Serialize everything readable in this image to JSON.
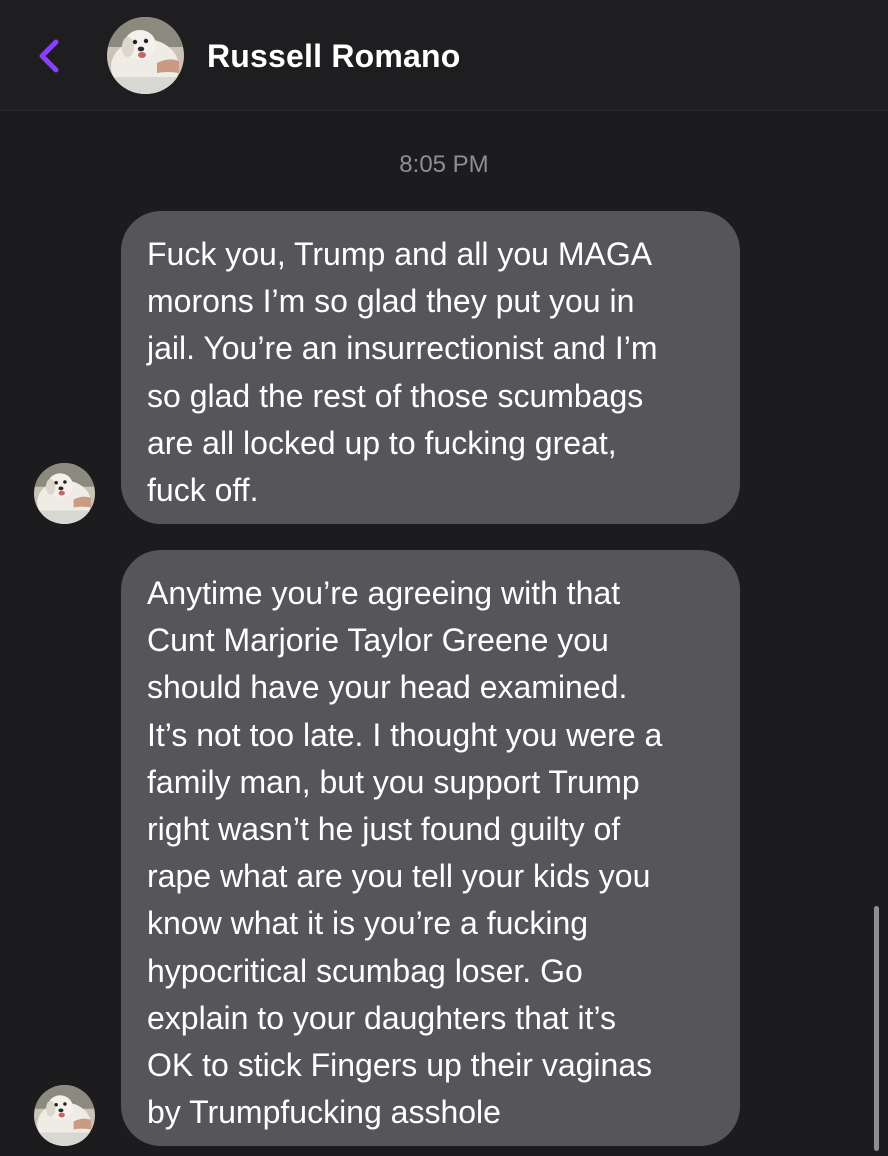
{
  "header": {
    "contact_name": "Russell Romano",
    "back_icon": "chevron-left-icon",
    "accent_color": "#8a3ffc"
  },
  "conversation": {
    "timestamp": "8:05 PM",
    "messages": [
      {
        "sender": "Russell Romano",
        "text": "Fuck you, Trump and all you MAGA\nmorons I’m so glad they put you in\njail. You’re an insurrectionist and I’m\nso glad the rest of those scumbags\nare all locked up to fucking great,\nfuck off."
      },
      {
        "sender": "Russell Romano",
        "text": "Anytime you’re agreeing with that\nCunt Marjorie Taylor Greene you\nshould have your head examined.\nIt’s not too late. I thought you were a\nfamily man, but you support Trump\nright wasn’t he just found guilty of\nrape what are you tell your kids you\nknow what it is you’re a fucking\nhypocritical scumbag loser. Go\nexplain to your daughters that it’s\nOK to stick Fingers up their  vaginas\nby Trumpfucking asshole"
      }
    ]
  },
  "colors": {
    "background": "#1c1c1e",
    "bubble": "#56565a",
    "timestamp": "#8e8e93"
  }
}
